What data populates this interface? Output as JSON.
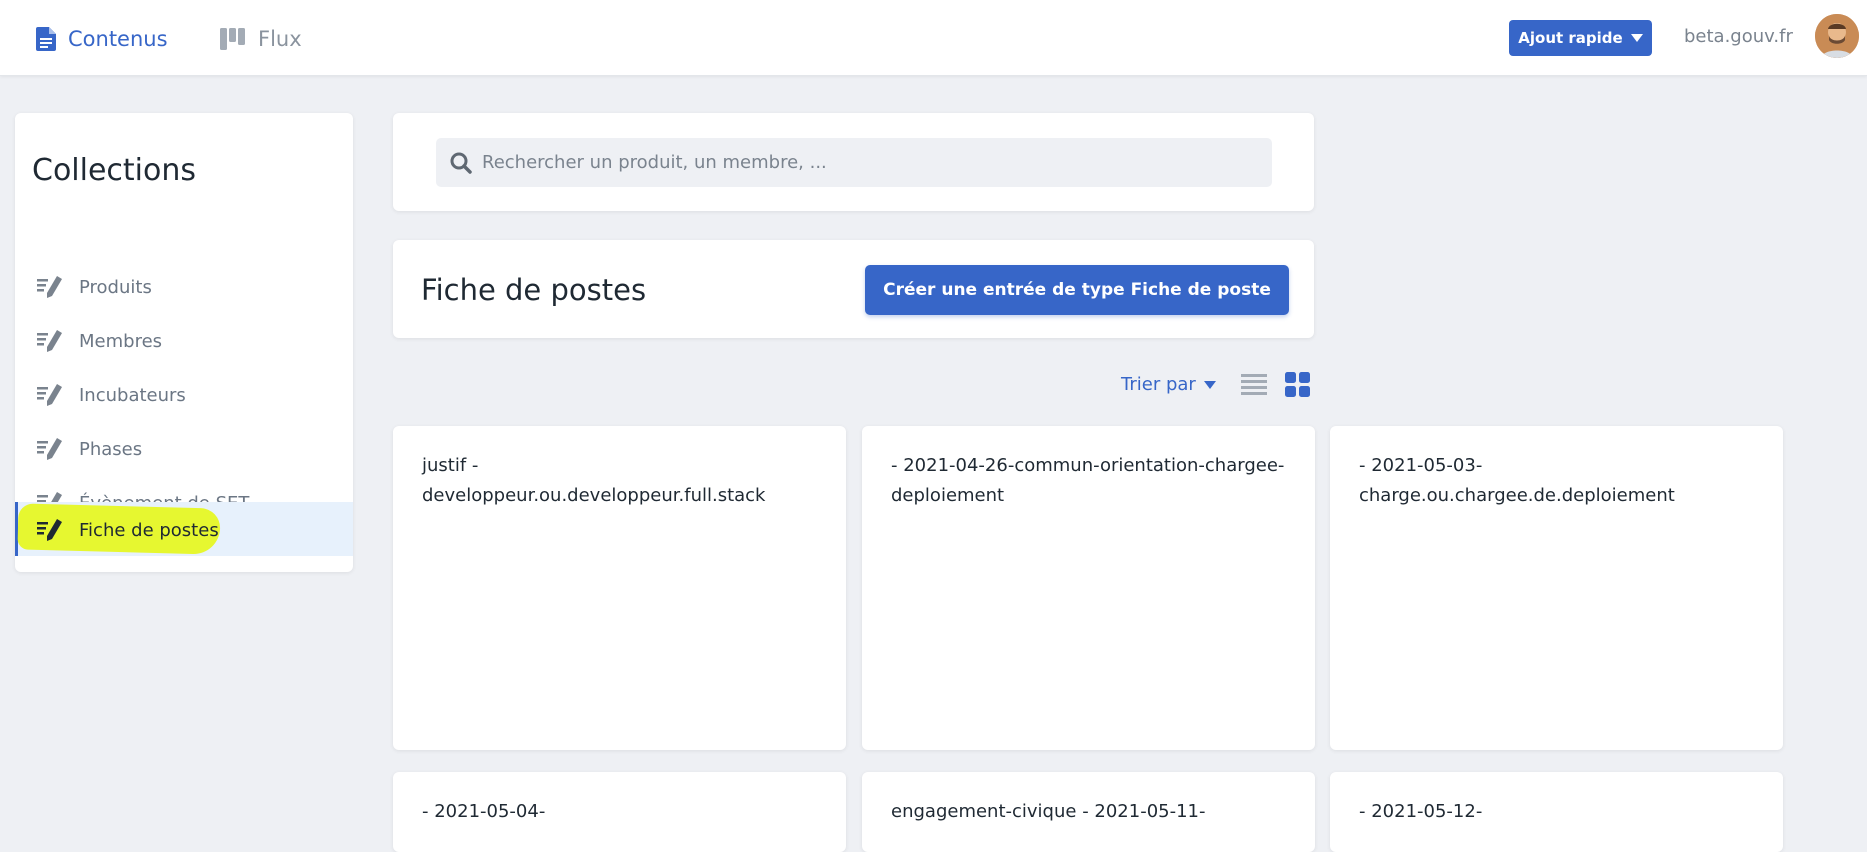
{
  "topbar": {
    "nav_contents": "Contenus",
    "nav_flux": "Flux",
    "quick_add": "Ajout rapide",
    "site": "beta.gouv.fr"
  },
  "sidebar": {
    "title": "Collections",
    "items": [
      {
        "label": "Produits"
      },
      {
        "label": "Membres"
      },
      {
        "label": "Incubateurs"
      },
      {
        "label": "Phases"
      },
      {
        "label": "Évènement de SET"
      },
      {
        "label": "Fiche de postes"
      }
    ],
    "active_index": 5
  },
  "search": {
    "placeholder": "Rechercher un produit, un membre, ..."
  },
  "header": {
    "title": "Fiche de postes",
    "create_label": "Créer une entrée de type Fiche de poste"
  },
  "toolbar": {
    "sort_label": "Trier par"
  },
  "cards": [
    {
      "title": "justif - developpeur.ou.developpeur.full.stack"
    },
    {
      "title": "- 2021-04-26-commun-orientation-chargee-deploiement"
    },
    {
      "title": "- 2021-05-03-charge.ou.chargee.de.deploiement"
    },
    {
      "title": "- 2021-05-04-"
    },
    {
      "title": "engagement-civique - 2021-05-11-"
    },
    {
      "title": "- 2021-05-12-"
    }
  ],
  "colors": {
    "accent": "#3766c8",
    "highlight": "#e6f71e",
    "background": "#eef0f4"
  }
}
